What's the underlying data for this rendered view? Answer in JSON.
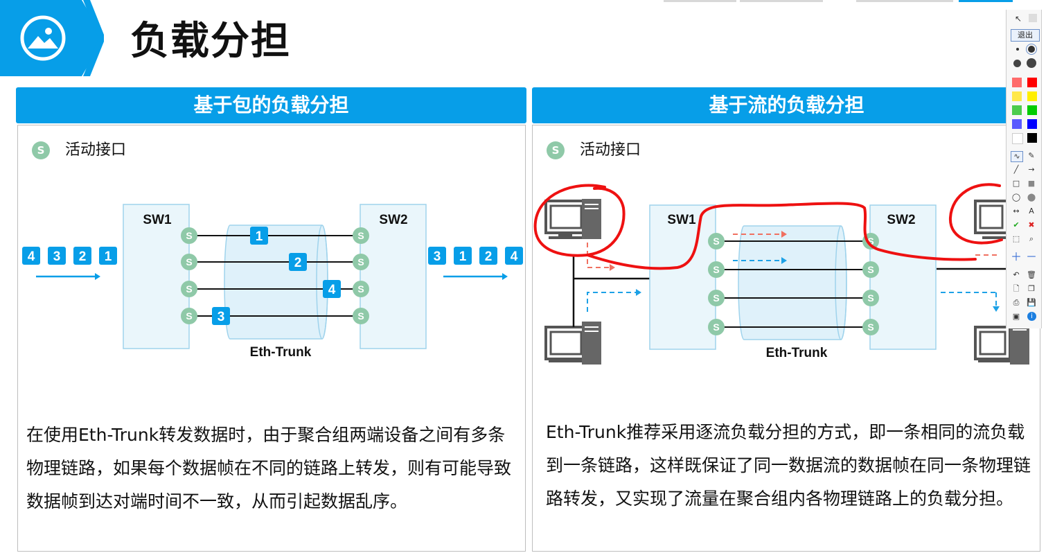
{
  "page": {
    "title": "负载分担"
  },
  "panels": [
    {
      "heading": "基于包的负载分担",
      "legend": "活动接口",
      "diagram": {
        "sw1": "SW1",
        "sw2": "SW2",
        "trunk": "Eth-Trunk",
        "port": "S",
        "in_frames": [
          "4",
          "3",
          "2",
          "1"
        ],
        "link_frames": [
          "1",
          "2",
          "4",
          "3"
        ],
        "out_frames": [
          "3",
          "1",
          "2",
          "4"
        ]
      },
      "text": "在使用Eth-Trunk转发数据时，由于聚合组两端设备之间有多条物理链路，如果每个数据帧在不同的链路上转发，则有可能导致数据帧到达对端时间不一致，从而引起数据乱序。"
    },
    {
      "heading": "基于流的负载分担",
      "legend": "活动接口",
      "diagram": {
        "sw1": "SW1",
        "sw2": "SW2",
        "trunk": "Eth-Trunk",
        "port": "S"
      },
      "text": "Eth-Trunk推荐采用逐流负载分担的方式，即一条相同的流负载到一条链路，这样既保证了同一数据流的数据帧在同一条物理链路转发，又实现了流量在聚合组内各物理链路上的负载分担。"
    }
  ],
  "toolbar": {
    "exit_label": "退出",
    "text_tool": "A",
    "colors": [
      "#ff6b6b",
      "#ff0000",
      "#ffe84a",
      "#ffee00",
      "#4ccc4c",
      "#00cc00",
      "#5a5aff",
      "#0000ff",
      "#ffffff",
      "#000000"
    ],
    "icons": [
      "pointer-icon",
      "dot-small-icon",
      "dot-large-icon",
      "pen-icon",
      "eraser-icon",
      "line-icon",
      "arrow-icon",
      "rect-icon",
      "rect-fill-icon",
      "ellipse-icon",
      "ellipse-fill-icon",
      "double-arrow-icon",
      "text-icon",
      "check-icon",
      "cross-icon",
      "select-icon",
      "zoom-icon",
      "plus-icon",
      "minus-icon",
      "undo-icon",
      "trash-icon",
      "new-page-icon",
      "copy-icon",
      "print-icon",
      "save-icon",
      "image-icon",
      "info-icon"
    ]
  },
  "annotation_color": "#ee1111",
  "accent_color": "#079ee8"
}
